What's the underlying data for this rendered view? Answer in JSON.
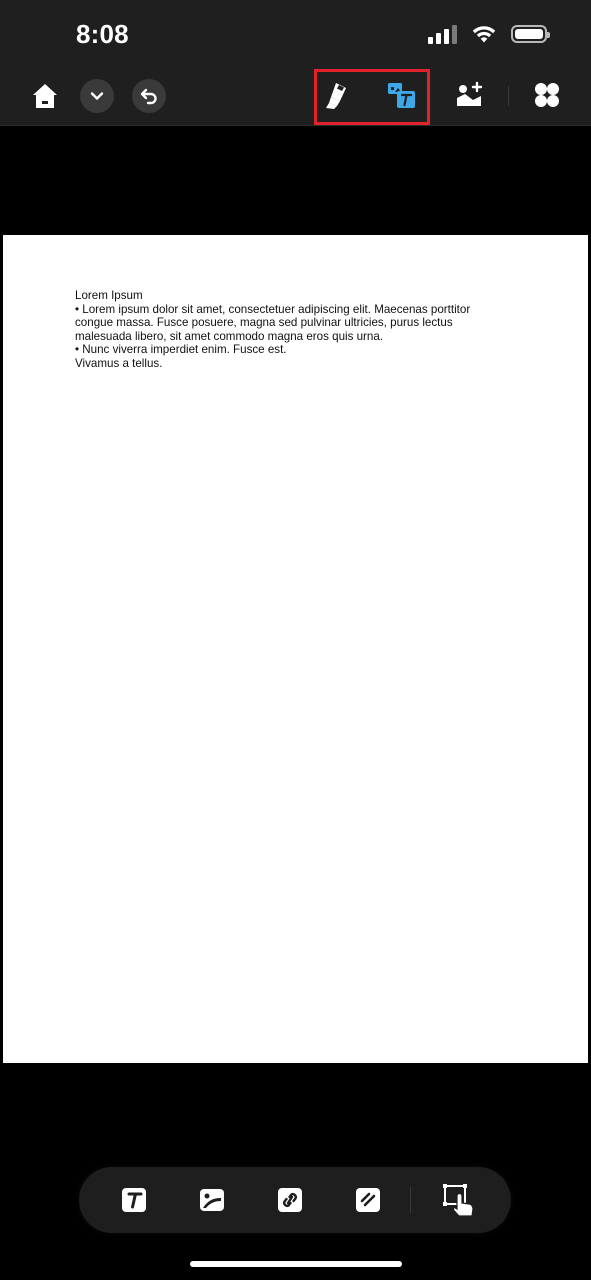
{
  "status_bar": {
    "time": "8:08",
    "icons": [
      "signal-icon",
      "wifi-icon",
      "battery-icon"
    ]
  },
  "toolbar": {
    "left": [
      "home-icon",
      "chevron-down-icon",
      "undo-icon"
    ],
    "right": [
      "highlighter-icon",
      "translate-text-icon",
      "add-image-icon",
      "apps-icon"
    ],
    "highlight_color": "#e0232b",
    "accent_color": "#3ea7e8"
  },
  "document": {
    "lines": [
      "Lorem Ipsum",
      "• Lorem ipsum dolor sit amet, consectetuer adipiscing elit. Maecenas porttitor",
      "congue massa. Fusce posuere, magna sed pulvinar ultricies, purus lectus",
      "malesuada libero, sit amet commodo magna eros quis urna.",
      "• Nunc viverra imperdiet enim. Fusce est.",
      "Vivamus a tellus."
    ]
  },
  "bottom_toolbar": {
    "icons": [
      "text-tool-icon",
      "image-tool-icon",
      "link-tool-icon",
      "shape-tool-icon",
      "select-tap-icon"
    ]
  }
}
